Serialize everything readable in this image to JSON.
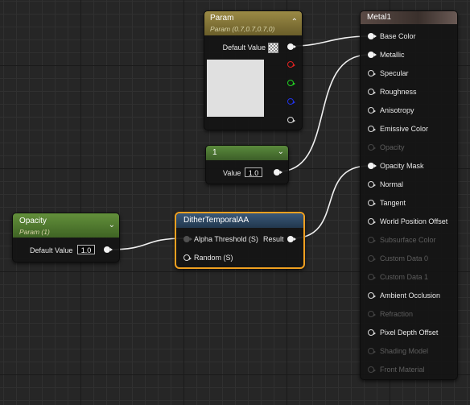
{
  "param_node": {
    "title": "Param",
    "subtitle": "Param (0.7,0.7,0.7,0)",
    "default_value_label": "Default Value",
    "header_color": "#8a7a3a",
    "preview_color": "#e0e0e0",
    "collapse_icon": "chevron-up-icon"
  },
  "constant_node": {
    "title": "1",
    "value_label": "Value",
    "value": "1.0",
    "header_color": "#4b7233",
    "collapse_icon": "chevron-down-icon"
  },
  "opacity_node": {
    "title": "Opacity",
    "subtitle": "Param (1)",
    "default_value_label": "Default Value",
    "value": "1.0",
    "header_color": "#557b32",
    "collapse_icon": "chevron-down-icon"
  },
  "dither_node": {
    "title": "DitherTemporalAA",
    "inputs": [
      "Alpha Threshold (S)",
      "Random (S)"
    ],
    "output": "Result",
    "header_color": "#2c4660",
    "border_color": "#f0a020"
  },
  "material_node": {
    "title": "Metal1",
    "inputs": [
      {
        "label": "Base Color",
        "state": "connected"
      },
      {
        "label": "Metallic",
        "state": "connected"
      },
      {
        "label": "Specular",
        "state": "open"
      },
      {
        "label": "Roughness",
        "state": "open"
      },
      {
        "label": "Anisotropy",
        "state": "open"
      },
      {
        "label": "Emissive Color",
        "state": "open"
      },
      {
        "label": "Opacity",
        "state": "disabled"
      },
      {
        "label": "Opacity Mask",
        "state": "connected"
      },
      {
        "label": "Normal",
        "state": "open"
      },
      {
        "label": "Tangent",
        "state": "open"
      },
      {
        "label": "World Position Offset",
        "state": "open"
      },
      {
        "label": "Subsurface Color",
        "state": "disabled"
      },
      {
        "label": "Custom Data 0",
        "state": "disabled"
      },
      {
        "label": "Custom Data 1",
        "state": "disabled"
      },
      {
        "label": "Ambient Occlusion",
        "state": "open"
      },
      {
        "label": "Refraction",
        "state": "disabled"
      },
      {
        "label": "Pixel Depth Offset",
        "state": "open"
      },
      {
        "label": "Shading Model",
        "state": "disabled"
      },
      {
        "label": "Front Material",
        "state": "disabled"
      }
    ]
  },
  "wire_color": "#f0f0f0"
}
